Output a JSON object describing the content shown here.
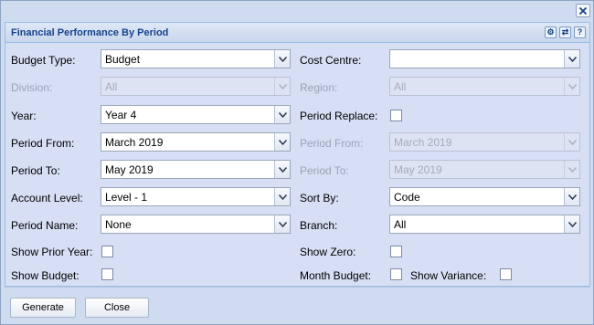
{
  "window": {
    "title": "Financial Performance By Period",
    "close_glyph": "✕",
    "tools": [
      "gear-icon",
      "refresh-icon",
      "help-icon"
    ],
    "help_glyph": "?",
    "refresh_glyph": "⇄",
    "gear_glyph": "⚙"
  },
  "fields": {
    "budget_type": {
      "label": "Budget Type:",
      "value": "Budget"
    },
    "cost_centre": {
      "label": "Cost Centre:",
      "value": ""
    },
    "division": {
      "label": "Division:",
      "value": "All"
    },
    "region": {
      "label": "Region:",
      "value": "All"
    },
    "year": {
      "label": "Year:",
      "value": "Year 4"
    },
    "period_replace": {
      "label": "Period Replace:"
    },
    "period_from": {
      "label": "Period From:",
      "value": "March 2019"
    },
    "period_from_2": {
      "label": "Period From:",
      "value": "March 2019"
    },
    "period_to": {
      "label": "Period To:",
      "value": "May 2019"
    },
    "period_to_2": {
      "label": "Period To:",
      "value": "May 2019"
    },
    "account_level": {
      "label": "Account Level:",
      "value": "Level - 1"
    },
    "sort_by": {
      "label": "Sort By:",
      "value": "Code"
    },
    "period_name": {
      "label": "Period Name:",
      "value": "None"
    },
    "branch": {
      "label": "Branch:",
      "value": "All"
    },
    "show_prior_year": {
      "label": "Show Prior Year:"
    },
    "show_zero": {
      "label": "Show Zero:"
    },
    "show_budget": {
      "label": "Show Budget:"
    },
    "month_budget": {
      "label": "Month Budget:"
    },
    "show_variance": {
      "label": "Show Variance:"
    }
  },
  "buttons": {
    "generate": "Generate",
    "close": "Close"
  },
  "colors": {
    "title": "#15428b",
    "panel_bg": "#d7dff5",
    "border": "#99bbe8"
  }
}
